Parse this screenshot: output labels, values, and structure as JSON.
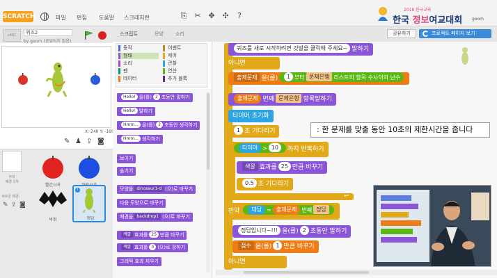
{
  "menubar": {
    "logo_text": "SCRATCH",
    "items": [
      "파일",
      "편집",
      "도움말",
      "스크래치란"
    ],
    "brand_title": "한국",
    "brand_title_mid": "정보",
    "brand_title_end": "여교대회",
    "brand_sub": "2018 한국교육"
  },
  "subbar": {
    "share_label": "공유하기",
    "project_page_label": "프로젝트 페이지 보기",
    "user_label": "goom"
  },
  "stage": {
    "version_label": "v461",
    "project_title": "퀴즈2",
    "owner": "by goorn (공유되지 않음)",
    "coords": "X: 240   Y: -169"
  },
  "sprites": {
    "stage_label": "무대\n배경 1개",
    "new_bg_label": "새로운 배경:",
    "tiles": [
      {
        "name": "빨간사과"
      },
      {
        "name": "파란사과"
      },
      {
        "name": "박쥐"
      },
      {
        "name": "정답"
      }
    ]
  },
  "tabs": [
    "스크립트",
    "모양",
    "소리"
  ],
  "categories": {
    "left": [
      "동작",
      "형태",
      "소리",
      "펜",
      "데이터"
    ],
    "right": [
      "이벤트",
      "제어",
      "관찰",
      "연산",
      "추가 블록"
    ],
    "colors": {
      "motion": "#4a6cd4",
      "looks": "#8a55d7",
      "sound": "#bb42c3",
      "pen": "#0e9a6c",
      "data": "#ee7d16",
      "events": "#c88330",
      "control": "#e1a91a",
      "sensing": "#2ca5e2",
      "operators": "#5cb712",
      "more": "#632d99"
    }
  },
  "palette_blocks": [
    {
      "pre": "",
      "pill": "Hello!",
      "post": "을(를)",
      "num": "2",
      "end": "초동안 말하기"
    },
    {
      "pre": "",
      "pill": "Hello!",
      "post": "말하기",
      "num": "",
      "end": ""
    },
    {
      "pre": "",
      "pill": "Hmm...",
      "post": "을(를)",
      "num": "2",
      "end": "초동안 생각하기"
    },
    {
      "pre": "",
      "pill": "Hmm...",
      "post": "생각하기",
      "num": "",
      "end": ""
    },
    {
      "pre": "보이기",
      "pill": "",
      "post": "",
      "num": "",
      "end": ""
    },
    {
      "pre": "숨기기",
      "pill": "",
      "post": "",
      "num": "",
      "end": ""
    },
    {
      "pre": "모양을",
      "pill": "",
      "dd": "dinosaur1-d",
      "post": "(으)로 바꾸기",
      "num": "",
      "end": ""
    },
    {
      "pre": "다음 모양으로 바꾸기",
      "pill": "",
      "post": "",
      "num": "",
      "end": ""
    },
    {
      "pre": "배경을",
      "pill": "",
      "dd": "backdrop1",
      "post": "(으)로 바꾸기",
      "num": "",
      "end": ""
    },
    {
      "pre": "",
      "pill": "",
      "dd": "색깔",
      "post": "효과를",
      "num": "25",
      "end": "만큼 바꾸기"
    },
    {
      "pre": "",
      "pill": "",
      "dd": "색깔",
      "post": "효과를",
      "num": "0",
      "end": "(으)로 정하기"
    },
    {
      "pre": "그래픽 효과 지우기",
      "pill": "",
      "post": "",
      "num": "",
      "end": ""
    }
  ],
  "script": {
    "b1_pill": "퀴즈를 새로 시작하려면 깃발을 클릭해 주세요~",
    "b1_end": "말하기",
    "b2": "아니면",
    "b3_var": "출제문제",
    "b3_mid": "을(를)",
    "b3_num": "1",
    "b3_from": "부터",
    "b3_list": "문제은행",
    "b3_end": "리스트의 항목 수",
    "b3_tail": "사이의 난수",
    "b4_var": "출제문제",
    "b4_mid": "번째",
    "b4_list": "문제은행",
    "b4_item": "항목",
    "b4_end": "말하기",
    "b5": "타이머 초기화",
    "b6_num": "1",
    "b6_end": "초 기다리기",
    "callout": ": 한 문제를 맞출 동안 10초의 제한시간을 줍니다",
    "b7_timer": "타이머",
    "b7_op": ">",
    "b7_num": "10",
    "b7_end": "까지 반복하기",
    "b8_dd": "색깔",
    "b8_mid": "효과를",
    "b8_num": "25",
    "b8_end": "만큼 바꾸기",
    "b9_num": "0.5",
    "b9_end": "초 기다리기",
    "b10_if": "만약",
    "b10_ans": "대답",
    "b10_eq": "=",
    "b10_var": "출제문제",
    "b10_nth": "번째",
    "b10_list": "정답",
    "b11_pill": "정답입니다~!!!",
    "b11_mid": "을(를)",
    "b11_num": "2",
    "b11_end": "초동안 말하기",
    "b12_dd": "점수",
    "b12_mid": "을(를)",
    "b12_num": "1",
    "b12_end": "만큼 바꾸기",
    "b13": "아니면"
  }
}
